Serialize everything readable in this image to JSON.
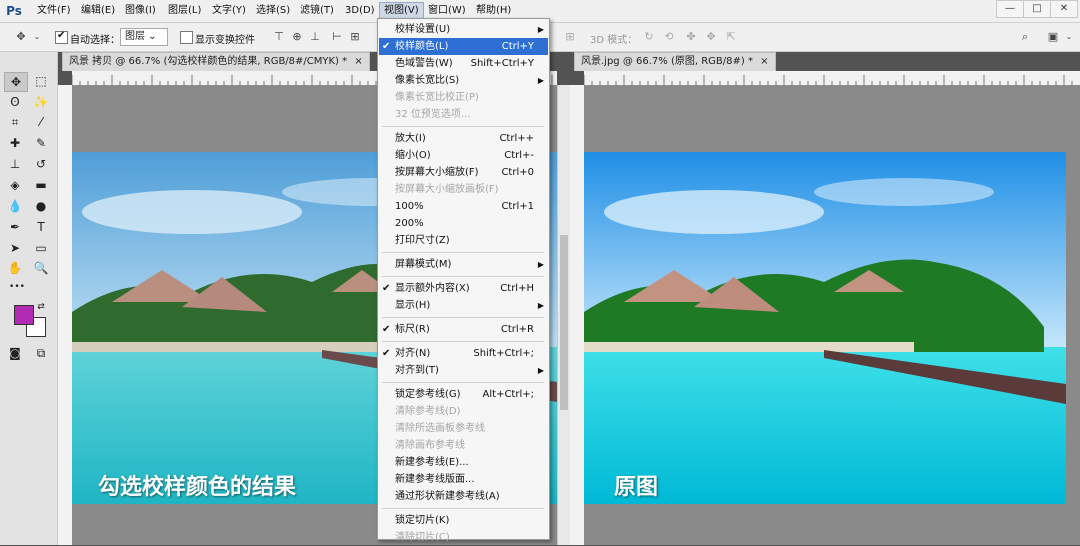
{
  "app": {
    "logo": "Ps"
  },
  "menubar": {
    "items": [
      "文件(F)",
      "编辑(E)",
      "图像(I)",
      "图层(L)",
      "文字(Y)",
      "选择(S)",
      "滤镜(T)",
      "3D(D)",
      "视图(V)",
      "窗口(W)",
      "帮助(H)"
    ],
    "window_controls": [
      "—",
      "□",
      "✕"
    ]
  },
  "options_bar": {
    "auto_select_label": "自动选择：",
    "auto_select_value": "图层",
    "show_transform_label": "显示变换控件",
    "mode_3d_label": "3D 模式："
  },
  "tools": {
    "icons": [
      "move-icon",
      "marquee-icon",
      "lasso-icon",
      "magic-wand-icon",
      "crop-icon",
      "eyedropper-icon",
      "healing-icon",
      "brush-icon",
      "stamp-icon",
      "history-brush-icon",
      "eraser-icon",
      "gradient-icon",
      "blur-icon",
      "dodge-icon",
      "pen-icon",
      "type-icon",
      "path-select-icon",
      "shape-icon",
      "hand-icon",
      "zoom-icon"
    ],
    "glyphs": [
      "✥",
      "⬚",
      "ʘ",
      "✨",
      "⌗",
      "⁄",
      "✚",
      "✎",
      "⊥",
      "↺",
      "◈",
      "▬",
      "💧",
      "●",
      "✒",
      "T",
      "➤",
      "▭",
      "✋",
      "🔍"
    ],
    "more": "•••",
    "fg_color": "#b12bb3",
    "bg_color": "#ffffff"
  },
  "documents": {
    "left_tab": "风景 拷贝 @ 66.7% (勾选校样颜色的结果, RGB/8#/CMYK) *",
    "left_close": "×",
    "left_caption": "勾选校样颜色的结果",
    "right_tab": "风景.jpg @ 66.7% (原图, RGB/8#) *",
    "right_close": "×",
    "right_caption": "原图"
  },
  "view_menu": {
    "items": [
      {
        "label": "校样设置(U)",
        "shortcut": "",
        "disabled": false,
        "checked": false,
        "submenu": true,
        "highlighted": false
      },
      {
        "label": "校样颜色(L)",
        "shortcut": "Ctrl+Y",
        "disabled": false,
        "checked": true,
        "submenu": false,
        "highlighted": true
      },
      {
        "label": "色域警告(W)",
        "shortcut": "Shift+Ctrl+Y",
        "disabled": false,
        "checked": false,
        "submenu": false,
        "highlighted": false
      },
      {
        "label": "像素长宽比(S)",
        "shortcut": "",
        "disabled": false,
        "checked": false,
        "submenu": true,
        "highlighted": false
      },
      {
        "label": "像素长宽比校正(P)",
        "shortcut": "",
        "disabled": true,
        "checked": false,
        "submenu": false,
        "highlighted": false
      },
      {
        "label": "32 位预览选项...",
        "shortcut": "",
        "disabled": true,
        "checked": false,
        "submenu": false,
        "highlighted": false
      },
      {
        "sep": true
      },
      {
        "label": "放大(I)",
        "shortcut": "Ctrl++",
        "disabled": false,
        "checked": false,
        "submenu": false,
        "highlighted": false
      },
      {
        "label": "缩小(O)",
        "shortcut": "Ctrl+-",
        "disabled": false,
        "checked": false,
        "submenu": false,
        "highlighted": false
      },
      {
        "label": "按屏幕大小缩放(F)",
        "shortcut": "Ctrl+0",
        "disabled": false,
        "checked": false,
        "submenu": false,
        "highlighted": false
      },
      {
        "label": "按屏幕大小缩放画板(F)",
        "shortcut": "",
        "disabled": true,
        "checked": false,
        "submenu": false,
        "highlighted": false
      },
      {
        "label": "100%",
        "shortcut": "Ctrl+1",
        "disabled": false,
        "checked": false,
        "submenu": false,
        "highlighted": false
      },
      {
        "label": "200%",
        "shortcut": "",
        "disabled": false,
        "checked": false,
        "submenu": false,
        "highlighted": false
      },
      {
        "label": "打印尺寸(Z)",
        "shortcut": "",
        "disabled": false,
        "checked": false,
        "submenu": false,
        "highlighted": false
      },
      {
        "sep": true
      },
      {
        "label": "屏幕模式(M)",
        "shortcut": "",
        "disabled": false,
        "checked": false,
        "submenu": true,
        "highlighted": false
      },
      {
        "sep": true
      },
      {
        "label": "显示额外内容(X)",
        "shortcut": "Ctrl+H",
        "disabled": false,
        "checked": true,
        "submenu": false,
        "highlighted": false
      },
      {
        "label": "显示(H)",
        "shortcut": "",
        "disabled": false,
        "checked": false,
        "submenu": true,
        "highlighted": false
      },
      {
        "sep": true
      },
      {
        "label": "标尺(R)",
        "shortcut": "Ctrl+R",
        "disabled": false,
        "checked": true,
        "submenu": false,
        "highlighted": false
      },
      {
        "sep": true
      },
      {
        "label": "对齐(N)",
        "shortcut": "Shift+Ctrl+;",
        "disabled": false,
        "checked": true,
        "submenu": false,
        "highlighted": false
      },
      {
        "label": "对齐到(T)",
        "shortcut": "",
        "disabled": false,
        "checked": false,
        "submenu": true,
        "highlighted": false
      },
      {
        "sep": true
      },
      {
        "label": "锁定参考线(G)",
        "shortcut": "Alt+Ctrl+;",
        "disabled": false,
        "checked": false,
        "submenu": false,
        "highlighted": false
      },
      {
        "label": "清除参考线(D)",
        "shortcut": "",
        "disabled": true,
        "checked": false,
        "submenu": false,
        "highlighted": false
      },
      {
        "label": "清除所选画板参考线",
        "shortcut": "",
        "disabled": true,
        "checked": false,
        "submenu": false,
        "highlighted": false
      },
      {
        "label": "清除画布参考线",
        "shortcut": "",
        "disabled": true,
        "checked": false,
        "submenu": false,
        "highlighted": false
      },
      {
        "label": "新建参考线(E)...",
        "shortcut": "",
        "disabled": false,
        "checked": false,
        "submenu": false,
        "highlighted": false
      },
      {
        "label": "新建参考线版面...",
        "shortcut": "",
        "disabled": false,
        "checked": false,
        "submenu": false,
        "highlighted": false
      },
      {
        "label": "通过形状新建参考线(A)",
        "shortcut": "",
        "disabled": false,
        "checked": false,
        "submenu": false,
        "highlighted": false
      },
      {
        "sep": true
      },
      {
        "label": "锁定切片(K)",
        "shortcut": "",
        "disabled": false,
        "checked": false,
        "submenu": false,
        "highlighted": false
      },
      {
        "label": "清除切片(C)",
        "shortcut": "",
        "disabled": true,
        "checked": false,
        "submenu": false,
        "highlighted": false
      }
    ]
  }
}
